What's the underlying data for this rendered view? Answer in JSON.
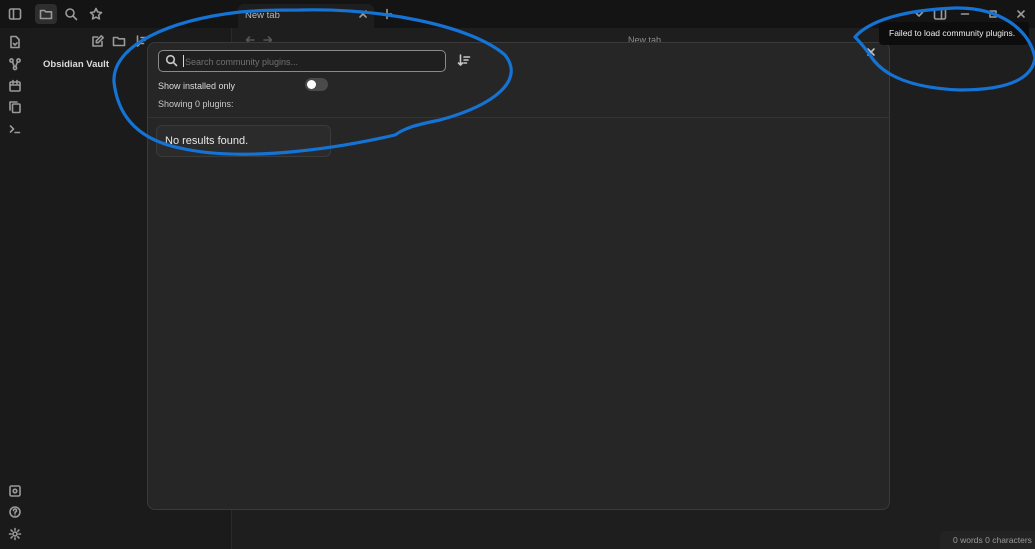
{
  "window": {
    "tab_label": "New tab",
    "main_title": "New tab"
  },
  "sidebar": {
    "vault_name": "Obsidian Vault"
  },
  "modal": {
    "search_placeholder": "Search community plugins...",
    "show_installed_label": "Show installed only",
    "show_installed_enabled": false,
    "showing_count": "Showing 0 plugins:",
    "no_results": "No results found."
  },
  "notice": {
    "text": "Failed to load community plugins."
  },
  "statusbar": {
    "text": "0 words  0 characters"
  },
  "colors": {
    "background": "#1e1e1e",
    "modal": "#262626",
    "annotation": "#1473d4"
  }
}
